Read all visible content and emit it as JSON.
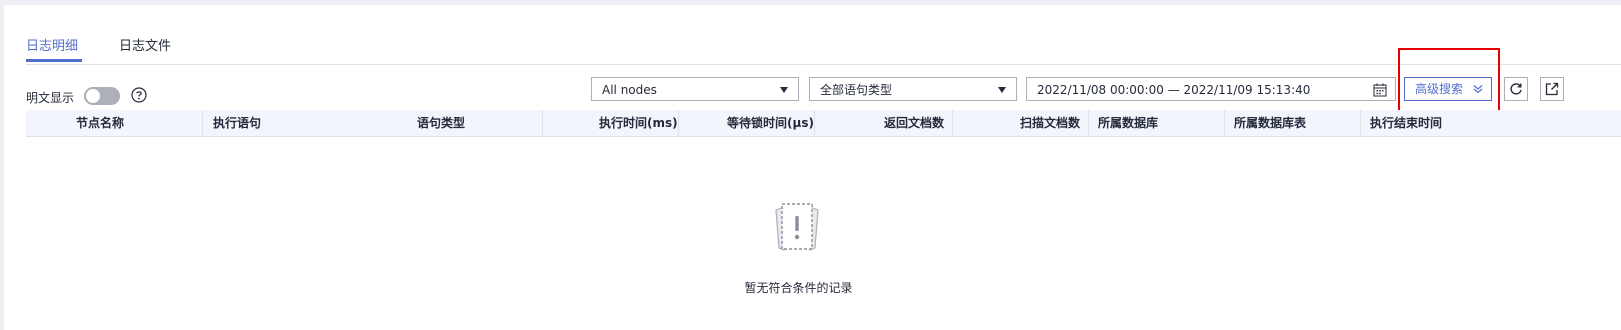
{
  "tabs": [
    {
      "label": "日志明细",
      "active": true
    },
    {
      "label": "日志文件",
      "active": false
    }
  ],
  "toolbar": {
    "plaintext_toggle_label": "明文显示",
    "plaintext_toggle_on": false,
    "node_select": "All nodes",
    "statement_type_select": "全部语句类型",
    "date_range": "2022/11/08 00:00:00 — 2022/11/09 15:13:40",
    "advanced_search_label": "高级搜索"
  },
  "table": {
    "columns": [
      "节点名称",
      "执行语句",
      "语句类型",
      "执行时间(ms)",
      "等待锁时间(μs)",
      "返回文档数",
      "扫描文档数",
      "所属数据库",
      "所属数据库表",
      "执行结束时间"
    ],
    "rows": []
  },
  "empty_message": "暂无符合条件的记录",
  "colors": {
    "accent": "#526ecc",
    "highlight_border": "#e60000",
    "toggle_off": "#adb0b8",
    "header_bg": "#f2f5fc"
  },
  "icons": [
    "help-icon",
    "calendar-icon",
    "chevron-double-down-icon",
    "refresh-icon",
    "export-icon",
    "empty-state-icon"
  ]
}
